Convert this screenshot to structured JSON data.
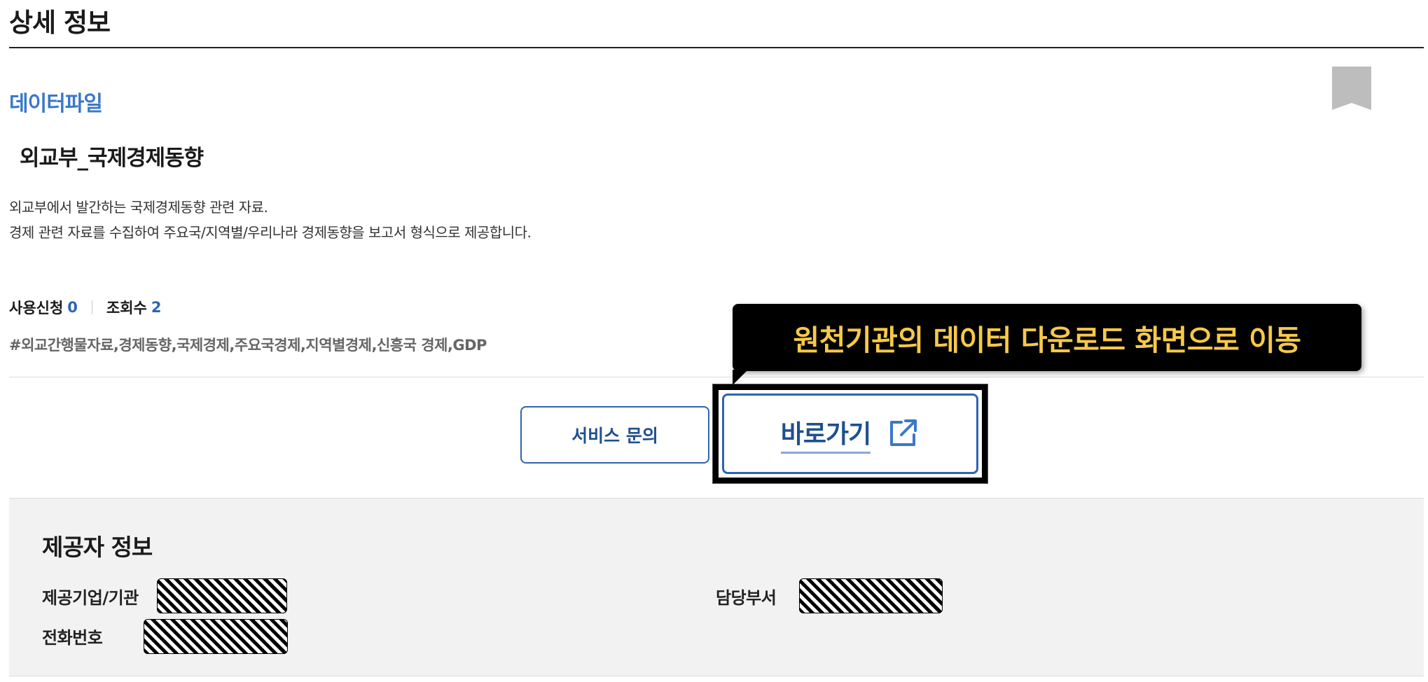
{
  "page": {
    "title": "상세 정보"
  },
  "dataset": {
    "type_label": "데이터파일",
    "title": "외교부_국제경제동향",
    "description": [
      "외교부에서 발간하는 국제경제동향 관련 자료.",
      "경제 관련 자료를 수집하여 주요국/지역별/우리나라 경제동향을 보고서 형식으로 제공합니다."
    ],
    "stats": {
      "requests_label": "사용신청",
      "requests_value": "0",
      "views_label": "조회수",
      "views_value": "2"
    },
    "tags": "#외교간행물자료,경제동향,국제경제,주요국경제,지역별경제,신흥국 경제,GDP"
  },
  "actions": {
    "inquiry_label": "서비스 문의",
    "goto_label": "바로가기"
  },
  "tooltip": {
    "text": "원천기관의 데이터 다운로드 화면으로 이동"
  },
  "provider": {
    "heading": "제공자 정보",
    "org_label": "제공기업/기관",
    "dept_label": "담당부서",
    "phone_label": "전화번호"
  },
  "icons": {
    "bookmark": "bookmark-icon",
    "external_link": "external-link-icon"
  },
  "colors": {
    "accent": "#2d64b4",
    "type_label": "#3a78c9",
    "tooltip_text": "#f7c948",
    "tooltip_bg": "#000000",
    "bookmark": "#bdbdbd"
  }
}
